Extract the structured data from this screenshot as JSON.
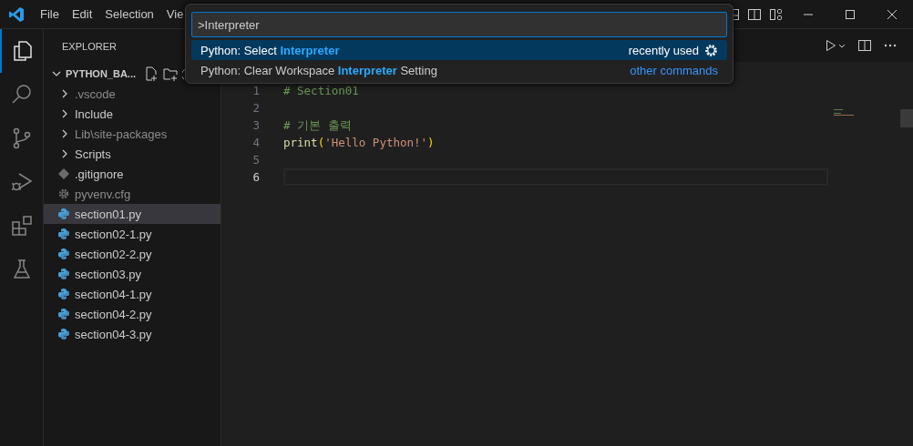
{
  "menu": [
    "File",
    "Edit",
    "Selection",
    "Vie"
  ],
  "explorer": {
    "title": "EXPLORER",
    "folder": "PYTHON_BA...",
    "expanded": true,
    "items": [
      {
        "label": ".vscode",
        "kind": "folder",
        "dimmed": true,
        "selected": false
      },
      {
        "label": "Include",
        "kind": "folder",
        "dimmed": false,
        "selected": false
      },
      {
        "label": "Lib\\site-packages",
        "kind": "folder",
        "dimmed": true,
        "selected": false
      },
      {
        "label": "Scripts",
        "kind": "folder",
        "dimmed": false,
        "selected": false
      },
      {
        "label": ".gitignore",
        "kind": "git",
        "dimmed": false,
        "selected": false
      },
      {
        "label": "pyvenv.cfg",
        "kind": "config",
        "dimmed": true,
        "selected": false
      },
      {
        "label": "section01.py",
        "kind": "python",
        "dimmed": false,
        "selected": true
      },
      {
        "label": "section02-1.py",
        "kind": "python",
        "dimmed": false,
        "selected": false
      },
      {
        "label": "section02-2.py",
        "kind": "python",
        "dimmed": false,
        "selected": false
      },
      {
        "label": "section03.py",
        "kind": "python",
        "dimmed": false,
        "selected": false
      },
      {
        "label": "section04-1.py",
        "kind": "python",
        "dimmed": false,
        "selected": false
      },
      {
        "label": "section04-2.py",
        "kind": "python",
        "dimmed": false,
        "selected": false
      },
      {
        "label": "section04-3.py",
        "kind": "python",
        "dimmed": false,
        "selected": false
      }
    ]
  },
  "editor": {
    "lines": [
      {
        "number": "1",
        "current": false,
        "tokens": [
          {
            "kind": "comment",
            "text": "# Section01"
          }
        ]
      },
      {
        "number": "2",
        "current": false
      },
      {
        "number": "3",
        "current": false,
        "tokens": [
          {
            "kind": "comment",
            "text": "# 기본 출력"
          }
        ]
      },
      {
        "number": "4",
        "current": false,
        "tokens": [
          {
            "kind": "function",
            "text": "print"
          },
          {
            "kind": "paren",
            "text": "("
          },
          {
            "kind": "string",
            "text": "'Hello Python!'"
          },
          {
            "kind": "paren",
            "text": ")"
          }
        ]
      },
      {
        "number": "5",
        "current": false
      },
      {
        "number": "6",
        "current": true
      }
    ]
  },
  "palette": {
    "value": ">Interpreter",
    "items": [
      {
        "label": "Python: Select **Interpreter**",
        "selected": true,
        "hint": {
          "kind": "recent",
          "text": "recently used"
        }
      },
      {
        "label": "Python: Clear Workspace **Interpreter** Setting",
        "selected": false,
        "hint": {
          "kind": "link",
          "text": "other commands"
        }
      }
    ]
  }
}
